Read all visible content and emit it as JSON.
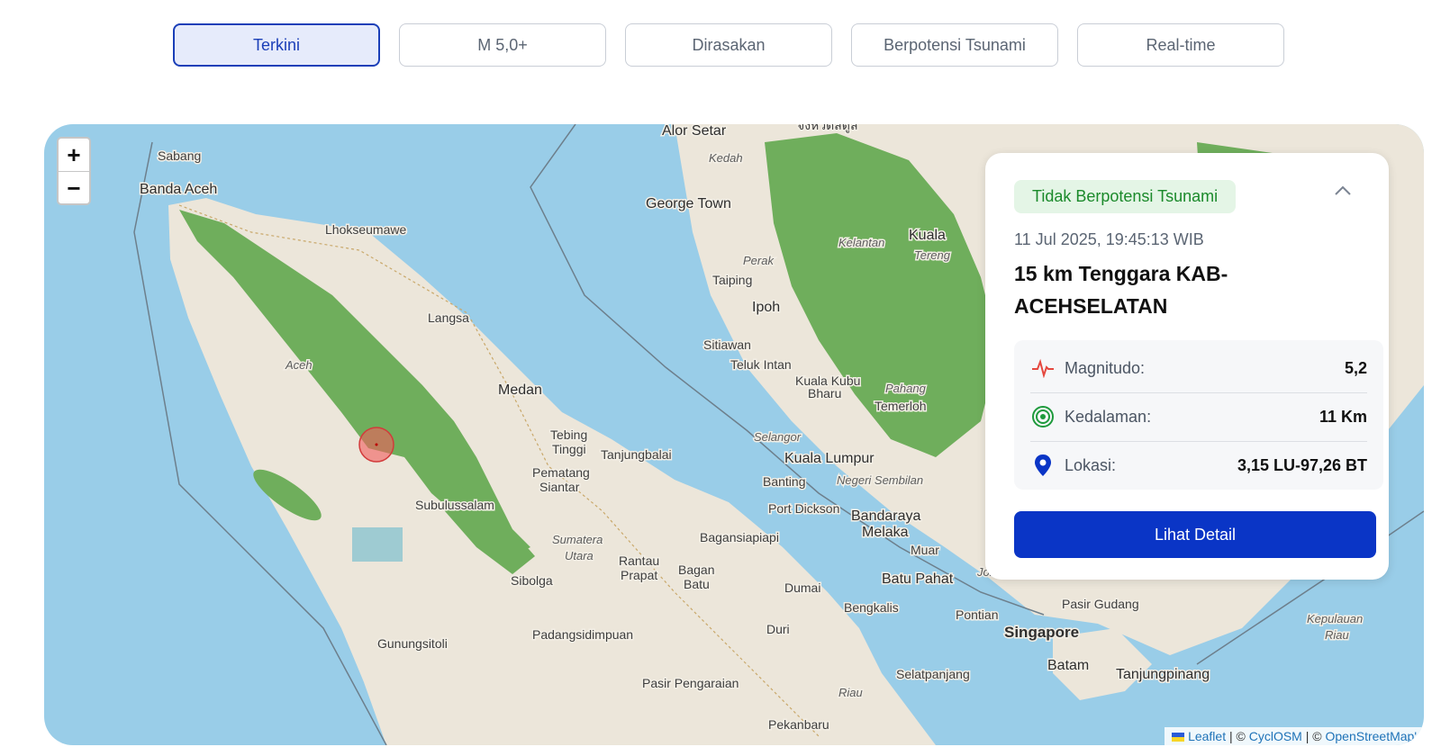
{
  "tabs": [
    {
      "label": "Terkini",
      "active": true
    },
    {
      "label": "M 5,0+",
      "active": false
    },
    {
      "label": "Dirasakan",
      "active": false
    },
    {
      "label": "Berpotensi Tsunami",
      "active": false
    },
    {
      "label": "Real-time",
      "active": false
    }
  ],
  "map": {
    "zoom_in": "+",
    "zoom_out": "−",
    "places": {
      "sabang": "Sabang",
      "banda_aceh": "Banda Aceh",
      "lhokseumawe": "Lhokseumawe",
      "langsa": "Langsa",
      "aceh": "Aceh",
      "medan": "Medan",
      "tebing_tinggi_1": "Tebing",
      "tebing_tinggi_2": "Tinggi",
      "tanjungbalai": "Tanjungbalai",
      "pematang_siantar_1": "Pematang",
      "pematang_siantar_2": "Siantar",
      "subulussalam": "Subulussalam",
      "sumatera_utara_1": "Sumatera",
      "sumatera_utara_2": "Utara",
      "rantau_prapat_1": "Rantau",
      "rantau_prapat_2": "Prapat",
      "bagan_batu_1": "Bagan",
      "bagan_batu_2": "Batu",
      "sibolga": "Sibolga",
      "bagansiapiapi": "Bagansiapiapi",
      "padangsidimpuan": "Padangsidimpuan",
      "gunungsitoli": "Gunungsitoli",
      "pasir_pengaraian": "Pasir Pengaraian",
      "pekanbaru": "Pekanbaru",
      "duri": "Duri",
      "dumai": "Dumai",
      "riau": "Riau",
      "bengkalis": "Bengkalis",
      "selatpanjang": "Selatpanjang",
      "alor_setar": "Alor Setar",
      "kedah": "Kedah",
      "george_town": "George Town",
      "perak": "Perak",
      "taiping": "Taiping",
      "ipoh": "Ipoh",
      "sitiawan": "Sitiawan",
      "teluk_intan": "Teluk Intan",
      "kuala_kubu_1": "Kuala Kubu",
      "kuala_kubu_2": "Bharu",
      "selangor": "Selangor",
      "kuala_lumpur": "Kuala Lumpur",
      "banting": "Banting",
      "negeri_sembilan": "Negeri Sembilan",
      "port_dickson": "Port Dickson",
      "bandaraya_1": "Bandaraya",
      "bandaraya_2": "Melaka",
      "muar": "Muar",
      "batu_pahat": "Batu Pahat",
      "johor": "Johor",
      "pontian": "Pontian",
      "pasir_gudang": "Pasir Gudang",
      "singapore": "Singapore",
      "batam": "Batam",
      "tanjungpinang": "Tanjungpinang",
      "kepulauan_1": "Kepulauan",
      "kepulauan_2": "Riau",
      "kelantan": "Kelantan",
      "kuala": "Kuala",
      "tereng": "Tereng",
      "pahang": "Pahang",
      "temerloh": "Temerloh",
      "thai_label": "จังหวัดสตูล"
    },
    "attribution": {
      "leaflet": "Leaflet",
      "sep1": " | © ",
      "cyclosm": "CyclOSM",
      "sep2": " | © ",
      "osm": "OpenStreetMap'"
    },
    "colors": {
      "sea": "#99cde8",
      "land": "#ece6da",
      "forest": "#6fae5c",
      "epicenter": "#f25c5c"
    }
  },
  "card": {
    "badge": "Tidak Berpotensi Tsunami",
    "datetime": "11 Jul 2025, 19:45:13 WIB",
    "title": "15 km Tenggara KAB-ACEHSELATAN",
    "rows": [
      {
        "icon": "pulse-icon",
        "label": "Magnitudo:",
        "value": "5,2"
      },
      {
        "icon": "target-icon",
        "label": "Kedalaman:",
        "value": "11 Km"
      },
      {
        "icon": "location-pin-icon",
        "label": "Lokasi:",
        "value": "3,15 LU-97,26 BT"
      }
    ],
    "button": "Lihat Detail",
    "colors": {
      "badge_bg": "#e4f5e6",
      "badge_text": "#1b8a2b",
      "button": "#0a35c6"
    }
  }
}
